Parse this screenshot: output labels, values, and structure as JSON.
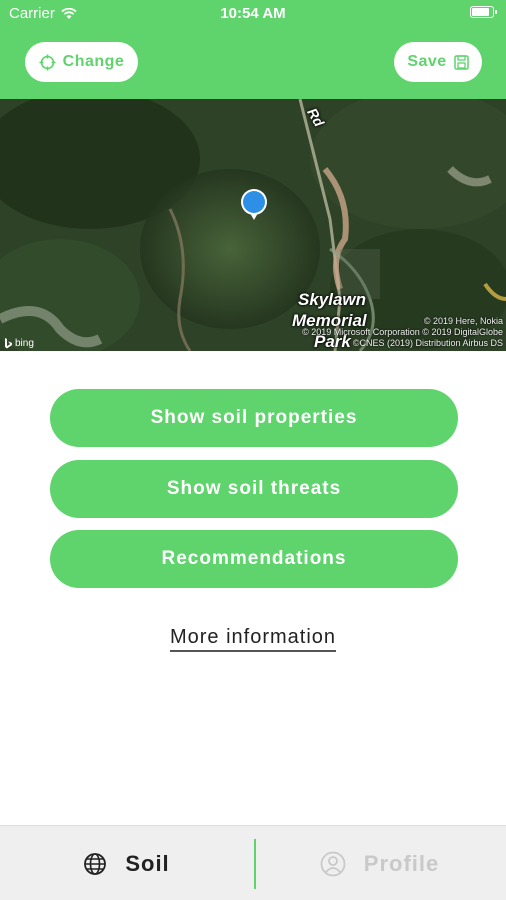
{
  "status": {
    "carrier": "Carrier",
    "time": "10:54 AM"
  },
  "header": {
    "change_label": "Change",
    "save_label": "Save"
  },
  "map": {
    "road_label": "Rd",
    "place_label_line1": "Skylawn",
    "place_label_line2": "Memorial",
    "place_label_line3": "Park",
    "credit_line1": "© 2019 Here, Nokia",
    "credit_line2": "© 2019 Microsoft Corporation © 2019 DigitalGlobe",
    "credit_line3": "©CNES (2019) Distribution Airbus DS",
    "provider": "bing"
  },
  "actions": {
    "properties": "Show soil properties",
    "threats": "Show soil threats",
    "recommendations": "Recommendations",
    "more_info": "More information"
  },
  "tabs": {
    "soil": "Soil",
    "profile": "Profile"
  },
  "colors": {
    "accent": "#5fd46d",
    "pin": "#2e8fe6",
    "inactive": "#c9c9c9"
  },
  "icons": {
    "change": "crosshair-icon",
    "save": "save-icon",
    "soil": "globe-icon",
    "profile": "user-icon",
    "pin": "map-pin-icon"
  }
}
